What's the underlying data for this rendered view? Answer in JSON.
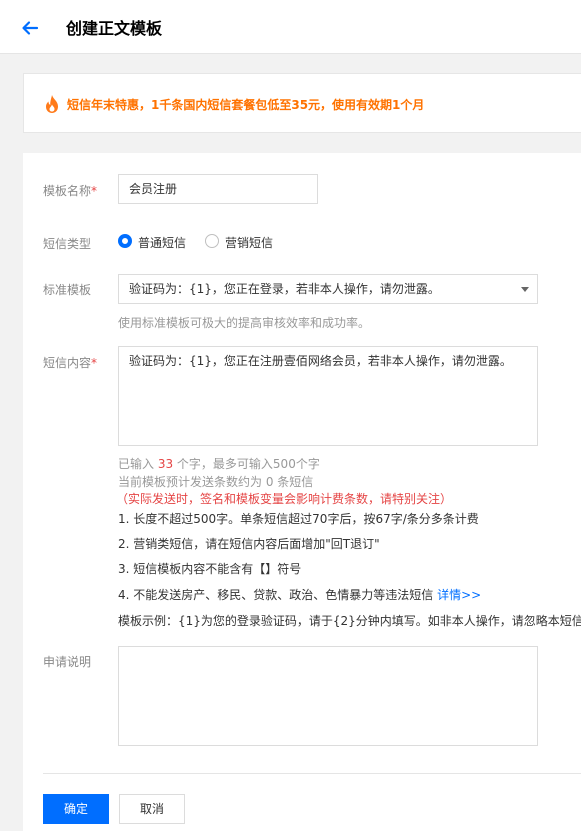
{
  "header": {
    "title": "创建正文模板",
    "back_icon": "arrow-left-icon",
    "accent": "#006eff"
  },
  "promo": {
    "icon": "flame-icon",
    "text": "短信年末特惠，1千条国内短信套餐包低至35元，使用有效期1个月",
    "color": "#ff7200"
  },
  "form": {
    "template_name": {
      "label": "模板名称",
      "required_mark": "*",
      "value": "会员注册"
    },
    "sms_type": {
      "label": "短信类型",
      "options": [
        {
          "label": "普通短信",
          "checked": true
        },
        {
          "label": "营销短信",
          "checked": false
        }
      ]
    },
    "standard_template": {
      "label": "标准模板",
      "value": "验证码为：{1}，您正在登录，若非本人操作，请勿泄露。",
      "hint": "使用标准模板可极大的提高审核效率和成功率。"
    },
    "content": {
      "label": "短信内容",
      "required_mark": "*",
      "value": "验证码为：{1}，您正在注册壹佰网络会员，若非本人操作，请勿泄露。",
      "count_prefix": "已输入 ",
      "count": "33",
      "count_suffix": " 个字，最多可输入500个字",
      "estimate": "当前模板预计发送条数约为 0 条短信",
      "warning": "（实际发送时，签名和模板变量会影响计费条数，请特别关注）",
      "rules": [
        "1. 长度不超过500字。单条短信超过70字后，按67字/条分多条计费",
        "2. 营销类短信，请在短信内容后面增加\"回T退订\"",
        "3. 短信模板内容不能含有【】符号",
        "4. 不能发送房产、移民、贷款、政治、色情暴力等违法短信 "
      ],
      "details_link": "详情>>",
      "example": "模板示例：{1}为您的登录验证码，请于{2}分钟内填写。如非本人操作，请忽略本短信。"
    },
    "description": {
      "label": "申请说明",
      "value": ""
    }
  },
  "actions": {
    "confirm": "确定",
    "cancel": "取消"
  }
}
